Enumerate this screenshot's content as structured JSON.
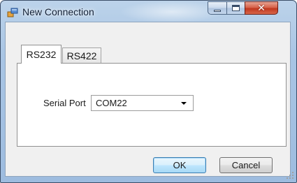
{
  "window": {
    "title": "New Connection"
  },
  "tabs": [
    {
      "label": "RS232",
      "selected": true
    },
    {
      "label": "RS422",
      "selected": false
    }
  ],
  "form": {
    "serial_port_label": "Serial Port",
    "serial_port_value": "COM22"
  },
  "buttons": {
    "ok_label": "OK",
    "cancel_label": "Cancel"
  },
  "icons": {
    "app": "window-app-icon",
    "minimize": "minimize-icon",
    "maximize": "maximize-icon",
    "close": "close-icon",
    "dropdown": "chevron-down-icon",
    "resize": "resize-grip-icon"
  },
  "colors": {
    "titlebar": "#a9c5e4",
    "client_bg": "#f0f0f0",
    "close_button": "#c0381f",
    "ok_border": "#3c7fb1"
  }
}
